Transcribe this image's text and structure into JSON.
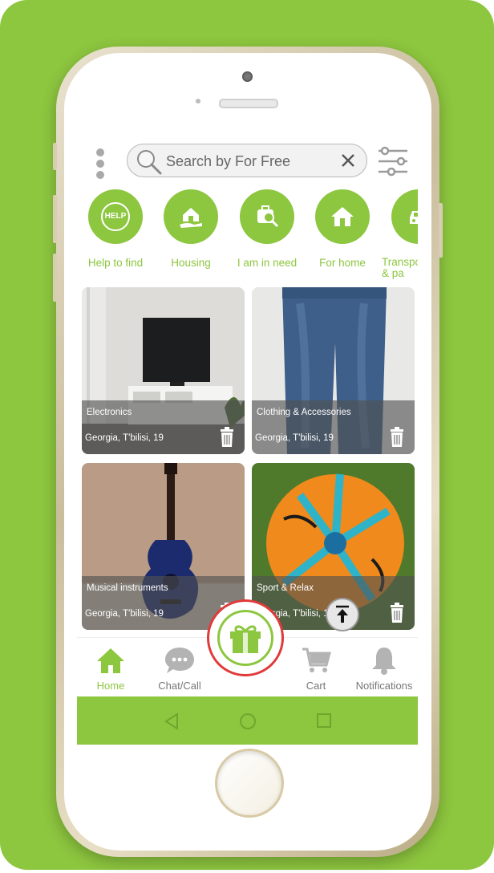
{
  "colors": {
    "brand": "#8dc63f",
    "background": "#ffffff",
    "highlight": "#e13a3a"
  },
  "search": {
    "placeholder": "Search by For Free",
    "value": ""
  },
  "categories": [
    {
      "label": "Help to find",
      "icon": "help-badge-icon",
      "badge": "HELP"
    },
    {
      "label": "Housing",
      "icon": "house-hand-icon"
    },
    {
      "label": "I am in need",
      "icon": "bag-search-icon"
    },
    {
      "label": "For home",
      "icon": "home-icon"
    },
    {
      "label": "Transpo\n& pa",
      "icon": "car-icon"
    }
  ],
  "listings": [
    {
      "title": "Electronics",
      "location": "Georgia, T'bilisi, 19"
    },
    {
      "title": "Clothing & Accessories",
      "location": "Georgia, T'bilisi, 19"
    },
    {
      "title": "Musical instruments",
      "location": "Georgia, T'bilisi, 19"
    },
    {
      "title": "Sport & Relax",
      "location": "Georgia, T'bilisi, 10"
    }
  ],
  "nav": [
    {
      "label": "Home",
      "icon": "home-icon",
      "active": true
    },
    {
      "label": "Chat/Call",
      "icon": "chat-bubble-icon"
    },
    {
      "label": "",
      "icon": "gift-icon"
    },
    {
      "label": "Cart",
      "icon": "cart-icon"
    },
    {
      "label": "Notifications",
      "icon": "bell-icon"
    }
  ],
  "system_nav": [
    "back-icon",
    "home-circle-icon",
    "recents-icon"
  ]
}
